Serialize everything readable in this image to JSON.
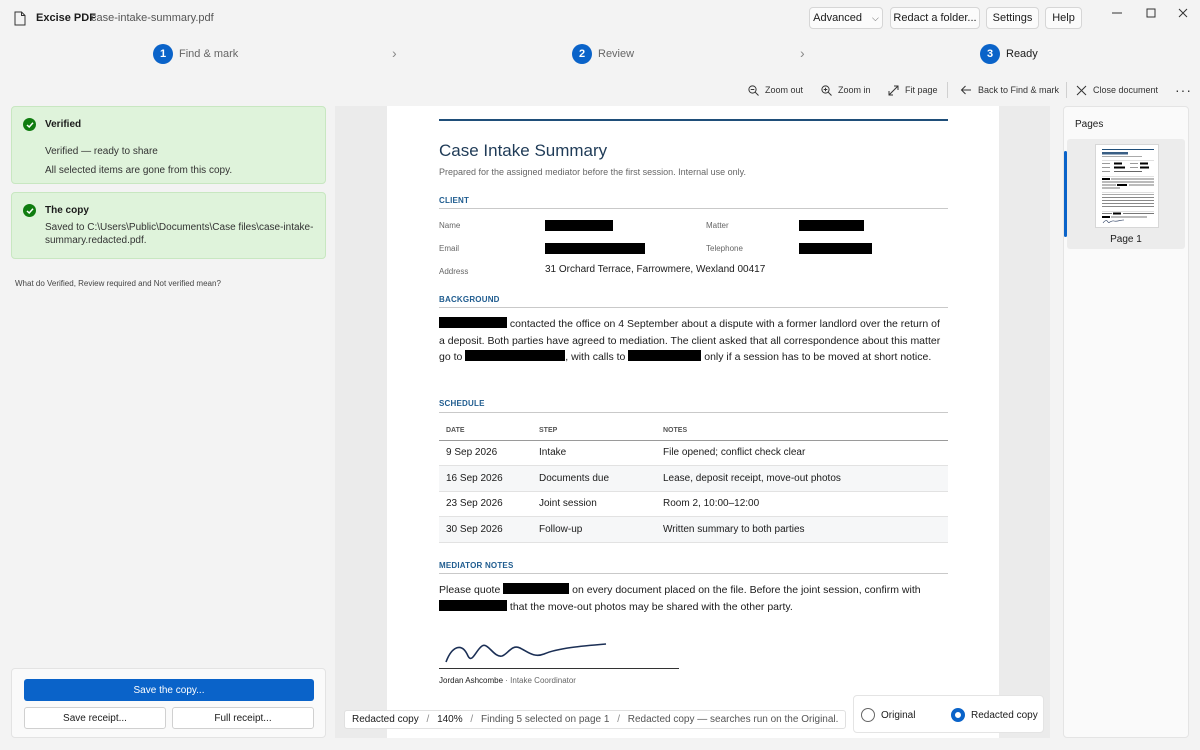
{
  "app": {
    "name": "Excise PDF",
    "file": "case-intake-summary.pdf",
    "buttons": {
      "advanced": "Advanced",
      "redact_folder": "Redact a folder...",
      "settings": "Settings",
      "help": "Help"
    }
  },
  "steps": [
    {
      "num": "1",
      "label": "Find & mark"
    },
    {
      "num": "2",
      "label": "Review"
    },
    {
      "num": "3",
      "label": "Ready"
    }
  ],
  "toolbar": {
    "zoom_out": "Zoom out",
    "zoom_in": "Zoom in",
    "fit_page": "Fit page",
    "back": "Back to Find & mark",
    "close": "Close document"
  },
  "left": {
    "verified": {
      "title": "Verified",
      "line1": "Verified — ready to share",
      "line2": "All selected items are gone from this copy."
    },
    "copy": {
      "title": "The copy",
      "line1": "Saved to C:\\Users\\Public\\Documents\\Case files\\case-intake-",
      "line2": "summary.redacted.pdf."
    },
    "help_link": "What do Verified, Review required and Not verified mean?",
    "save_copy": "Save the copy...",
    "save_receipt": "Save receipt...",
    "full_receipt": "Full receipt..."
  },
  "doc": {
    "title": "Case Intake Summary",
    "subtitle": "Prepared for the assigned mediator before the first session. Internal use only.",
    "client_h": "CLIENT",
    "labels": {
      "name": "Name",
      "matter": "Matter",
      "email": "Email",
      "telephone": "Telephone",
      "address": "Address"
    },
    "address": "31 Orchard Terrace, Farrowmere, Wexland 00417",
    "background_h": "BACKGROUND",
    "bg": {
      "t1": " contacted the office on 4 September about a dispute with a former landlord over the return of a deposit. Both parties have agreed to mediation. The client asked that all correspondence about this matter go to ",
      "t2": ", with calls to ",
      "t3": " only if a session has to be moved at short notice."
    },
    "schedule_h": "SCHEDULE",
    "schedule_cols": [
      "DATE",
      "STEP",
      "NOTES"
    ],
    "schedule_rows": [
      [
        "9 Sep 2026",
        "Intake",
        "File opened; conflict check clear"
      ],
      [
        "16 Sep 2026",
        "Documents due",
        "Lease, deposit receipt, move-out photos"
      ],
      [
        "23 Sep 2026",
        "Joint session",
        "Room 2, 10:00–12:00"
      ],
      [
        "30 Sep 2026",
        "Follow-up",
        "Written summary to both parties"
      ]
    ],
    "notes_h": "MEDIATOR NOTES",
    "notes": {
      "t1": "Please quote ",
      "t2": " on every document placed on the file. Before the joint session, confirm with ",
      "t3": " that the move-out photos may be shared with the other party."
    },
    "signer": "Jordan Ashcombe",
    "signer_role": " · Intake Coordinator"
  },
  "status": {
    "view": "Redacted copy",
    "sep": "/",
    "zoom": "140%",
    "info": "Finding 5 selected on page 1",
    "note": "Redacted copy — searches run on the Original."
  },
  "view_toggle": {
    "original": "Original",
    "redacted": "Redacted copy",
    "selected": "redacted"
  },
  "pages": {
    "title": "Pages",
    "items": [
      {
        "label": "Page 1"
      }
    ]
  },
  "colors": {
    "accent": "#0a63c9",
    "verified_bg": "#dff3db",
    "check": "#107c10",
    "heading": "#1f5c8f"
  }
}
